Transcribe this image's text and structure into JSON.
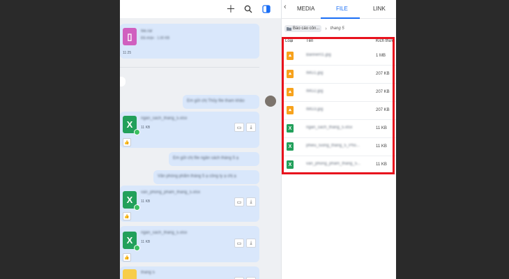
{
  "panel": {
    "tabs": [
      {
        "label": "MEDIA"
      },
      {
        "label": "FILE"
      },
      {
        "label": "LINK"
      }
    ],
    "breadcrumb": {
      "folder": "Báo cáo côn...",
      "current": "thang 5"
    },
    "columns": {
      "type": "Loại",
      "name": "Tên",
      "size": "Kích thướ"
    },
    "files": [
      {
        "type": "image",
        "name": "Banner01.jpg",
        "size": "1 MB"
      },
      {
        "type": "image",
        "name": "IMG1.jpg",
        "size": "207 KB"
      },
      {
        "type": "image",
        "name": "IMG2.jpg",
        "size": "207 KB"
      },
      {
        "type": "image",
        "name": "IMG3.jpg",
        "size": "207 KB"
      },
      {
        "type": "excel",
        "name": "ngan_sach_thang_5.xlsx",
        "size": "11 KB"
      },
      {
        "type": "excel",
        "name": "phieu_luong_thang_5_Pho...",
        "size": "11 KB"
      },
      {
        "type": "excel",
        "name": "van_phong_pham_thang_5...",
        "size": "11 KB"
      }
    ]
  },
  "chat": {
    "time_top": "11:25",
    "sizes": [
      "11 KB",
      "11 KB",
      "11 KB"
    ],
    "file_names": [
      "ngan_sach_thang_5.xlsx",
      "van_phong_pham_thang_5.xlsx",
      "ngan_sach_thang_5.xlsx",
      "thang 5"
    ],
    "messages": [
      "Em gửi chị Thủy file tham khảo",
      "Em gửi chị file ngân sách tháng 5 ạ",
      "Văn phòng phẩm tháng 5 ạ công ty ạ chị ạ"
    ],
    "top_file": "file.rar",
    "top_size": "Đã nhận · 1.00 KB"
  },
  "colors": {
    "accent": "#1a6ef5",
    "highlight": "#e8121d",
    "excel": "#22a05b",
    "image": "#f7a21c"
  }
}
